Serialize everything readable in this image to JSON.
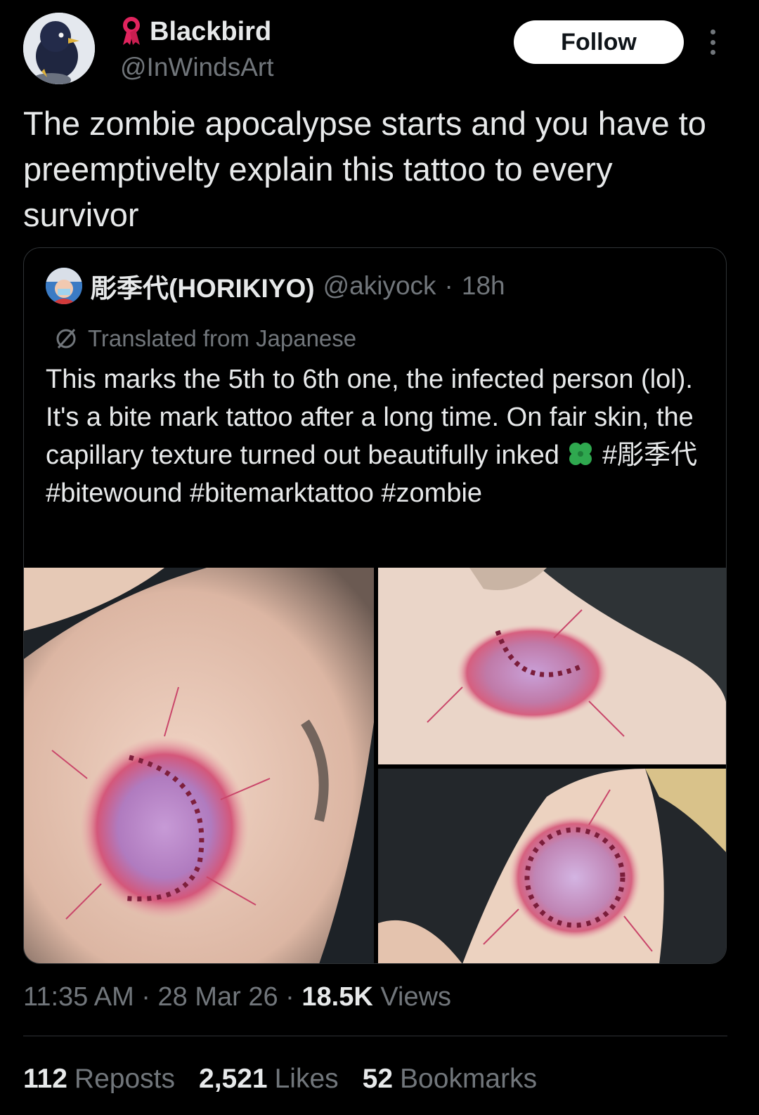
{
  "author": {
    "display_name": "Blackbird",
    "handle": "@InWindsArt",
    "badge_icon": "ribbon-icon"
  },
  "actions": {
    "follow_label": "Follow",
    "more_icon": "more-vertical-icon"
  },
  "tweet": {
    "text": "The zombie apocalypse starts and you have to preemptivelty explain this tattoo to every survivor"
  },
  "quote": {
    "display_name": "彫季代(HORIKIYO)",
    "handle": "@akiyock",
    "separator": "·",
    "time": "18h",
    "translated_label": "Translated from Japanese",
    "text_before_icon": "This marks the 5th to 6th one, the infected person (lol). It's a bite mark tattoo after a long time. On fair skin, the capillary texture turned out beautifully inked",
    "text_after_icon": "#彫季代 #bitewound #bitemarktattoo #zombie",
    "media_alts": [
      "bite mark tattoo on neck",
      "bite mark tattoo on shoulder",
      "bite mark tattoo on neck side"
    ]
  },
  "meta": {
    "time": "11:35 AM",
    "sep1": "·",
    "date": "28 Mar 26",
    "sep2": "·",
    "views_count": "18.5K",
    "views_label": "Views"
  },
  "stats": {
    "reposts_count": "112",
    "reposts_label": "Reposts",
    "likes_count": "2,521",
    "likes_label": "Likes",
    "bookmarks_count": "52",
    "bookmarks_label": "Bookmarks"
  },
  "colors": {
    "background": "#000000",
    "text_primary": "#e7e9ea",
    "text_secondary": "#71767b",
    "border": "#2f3336",
    "follow_bg": "#ffffff",
    "clover": "#2fa84f"
  }
}
